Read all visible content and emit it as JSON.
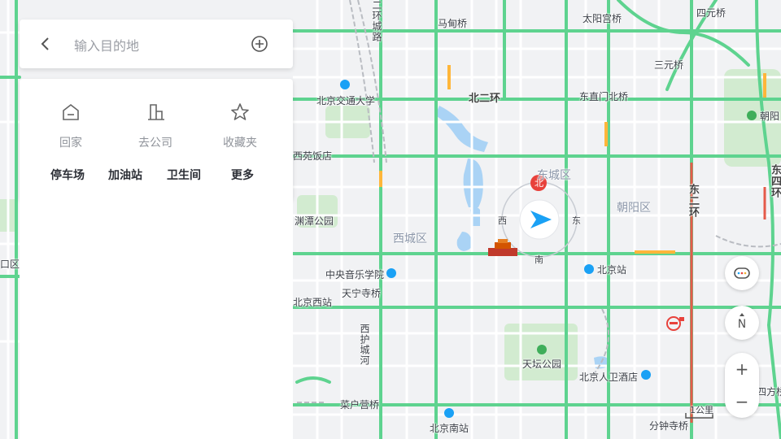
{
  "search": {
    "placeholder": "输入目的地"
  },
  "shortcuts": [
    {
      "label": "回家",
      "icon": "home-icon"
    },
    {
      "label": "去公司",
      "icon": "office-icon"
    },
    {
      "label": "收藏夹",
      "icon": "star-icon"
    }
  ],
  "quick_links": [
    "停车场",
    "加油站",
    "卫生间",
    "更多"
  ],
  "map_labels": {
    "roads": [
      "北二环",
      "东二环",
      "西护城河",
      "二环城路"
    ],
    "bridges": [
      "马甸桥",
      "太阳宫桥",
      "四元桥",
      "三元桥",
      "东直门北桥",
      "菜户营桥",
      "分钟寺桥",
      "四方桥"
    ],
    "districts": [
      "东城区",
      "西城区",
      "朝阳区",
      "丰台区"
    ],
    "pois": [
      "北京交通大学",
      "西苑饭店",
      "渊潭公园",
      "中央音乐学院",
      "天宁寺桥",
      "北京西站",
      "天坛公园",
      "北京人卫酒店",
      "北京站",
      "北京南站",
      "朝阳公园"
    ],
    "partial": [
      "四方桥",
      "朝阳",
      "东四环",
      "口区"
    ]
  },
  "compass": {
    "north": "北",
    "east": "东",
    "south": "南",
    "west": "西"
  },
  "scale": {
    "text": "1公里"
  },
  "controls": {
    "north_label": "N",
    "zoom_in": "+",
    "zoom_out": "−"
  },
  "colors": {
    "road_major": "#5ed38f",
    "road_minor": "#ffffff",
    "water": "#aad3f5",
    "park": "#d2ebd0",
    "accent": "#1aa1f5",
    "marker_red": "#e8413b",
    "congestion": "#ffb63a"
  }
}
